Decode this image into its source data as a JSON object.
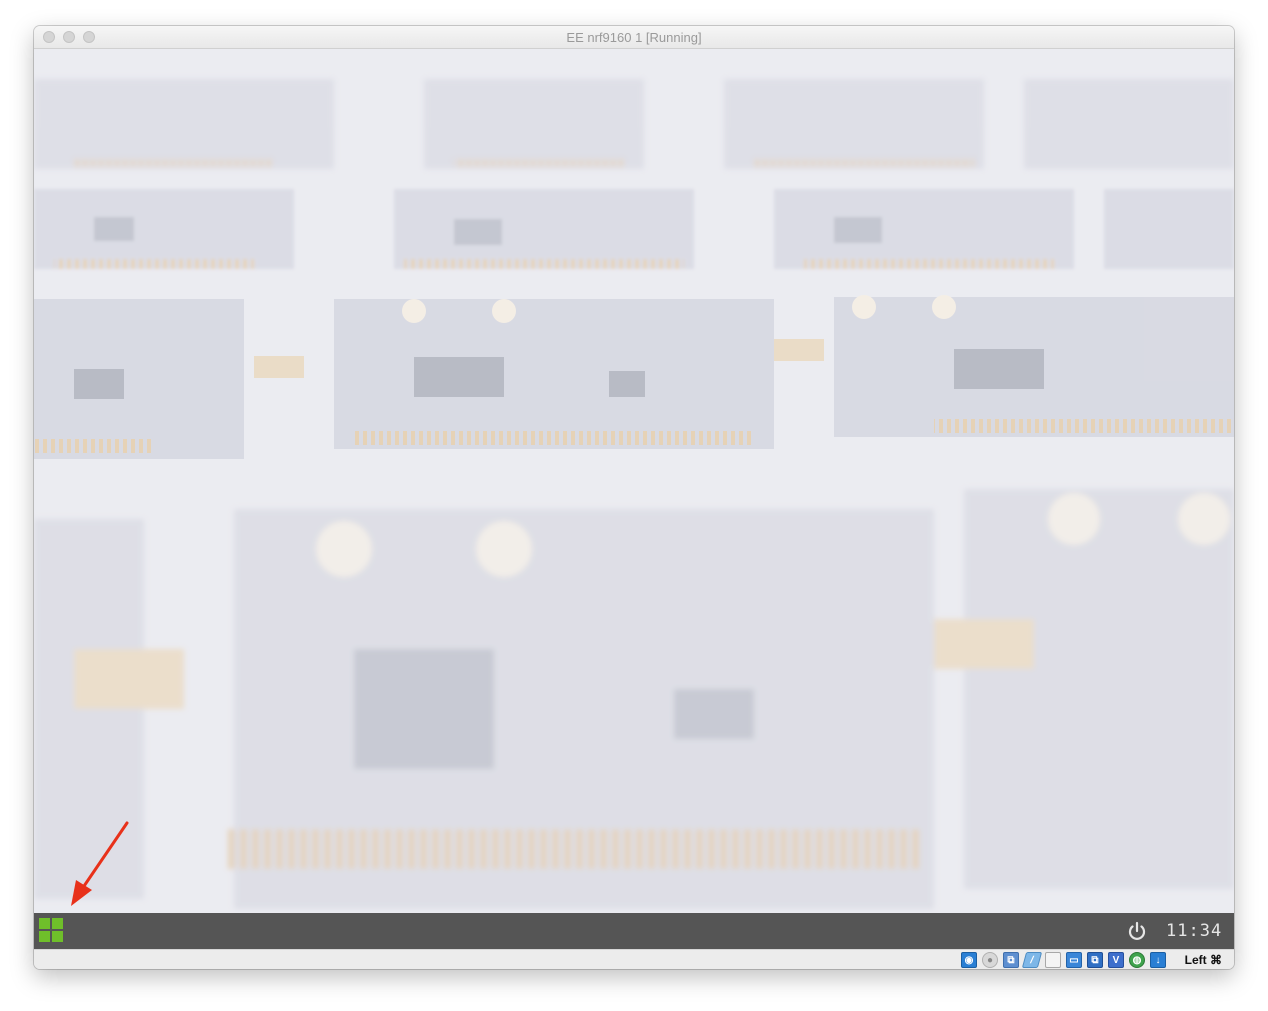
{
  "window": {
    "title": "EE nrf9160 1 [Running]"
  },
  "taskbar": {
    "start_icon": "grid-start-icon",
    "power_icon": "power-icon",
    "clock": "11:34",
    "accent_color": "#6fbf2a"
  },
  "statusbar": {
    "icons": [
      "hard-disk-icon",
      "optical-drive-icon",
      "usb-icon",
      "shared-folders-icon",
      "display-icon",
      "screen-capture-icon",
      "network-icon",
      "virtualbox-icon",
      "mouse-integration-icon",
      "keyboard-capture-icon"
    ],
    "host_key": "Left ⌘"
  },
  "annotation": {
    "arrow_color": "#e8311a"
  }
}
